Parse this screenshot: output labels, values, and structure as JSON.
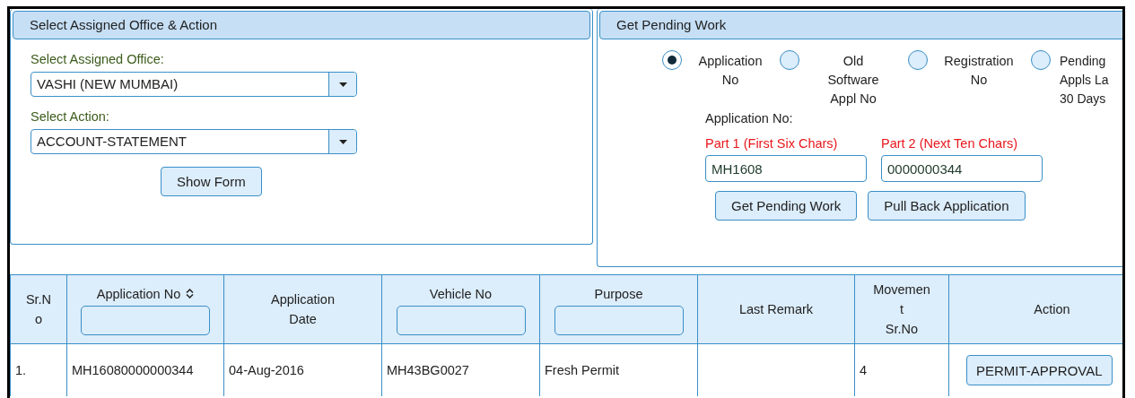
{
  "office_panel": {
    "title": "Select Assigned Office & Action",
    "office_label": "Select Assigned Office:",
    "office_value": "VASHI (NEW MUMBAI)",
    "action_label": "Select Action:",
    "action_value": "ACCOUNT-STATEMENT",
    "button": "Show Form"
  },
  "pending_panel": {
    "title": "Get Pending Work",
    "search_by": [
      {
        "label": "Application\nNo",
        "selected": true
      },
      {
        "label": "Old\nSoftware\nAppl No",
        "selected": false
      },
      {
        "label": "Registration\nNo",
        "selected": false
      },
      {
        "label": "Pending\nAppls La\n30 Days",
        "selected": false
      }
    ],
    "field_label": "Application No:",
    "part1": {
      "label": "Part 1 (First Six Chars)",
      "value": "MH1608"
    },
    "part2": {
      "label": "Part 2 (Next Ten Chars)",
      "value": "0000000344"
    },
    "buttons": [
      "Get Pending Work",
      "Pull Back Application"
    ]
  },
  "table": {
    "columns": [
      {
        "label": "Sr.N\no",
        "kind": "plain"
      },
      {
        "label": "Application No",
        "kind": "sort-filter"
      },
      {
        "label": "Application\nDate",
        "kind": "plain"
      },
      {
        "label": "Vehicle No",
        "kind": "filter"
      },
      {
        "label": "Purpose",
        "kind": "filter"
      },
      {
        "label": "Last Remark",
        "kind": "plain"
      },
      {
        "label": "Movemen\nt\nSr.No",
        "kind": "plain"
      },
      {
        "label": "Action",
        "kind": "plain"
      }
    ],
    "rows": [
      {
        "sr_no": "1.",
        "application_no": "MH16080000000344",
        "application_date": "04-Aug-2016",
        "vehicle_no": "MH43BG0027",
        "purpose": "Fresh Permit",
        "movement_sr_no": "4",
        "action": "PERMIT-APPROVAL"
      }
    ]
  }
}
